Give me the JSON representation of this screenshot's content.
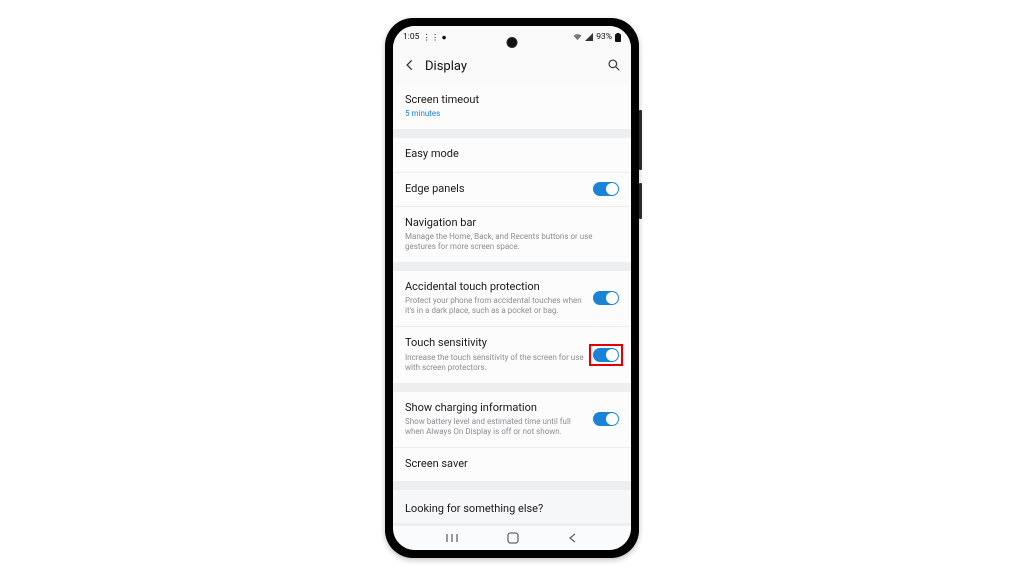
{
  "statusbar": {
    "time": "1:05",
    "battery_pct": "93%"
  },
  "header": {
    "title": "Display"
  },
  "group1": {
    "screen_timeout_label": "Screen timeout",
    "screen_timeout_value": "5 minutes"
  },
  "group2": {
    "easy_mode": "Easy mode",
    "edge_panels": "Edge panels",
    "nav_bar": "Navigation bar",
    "nav_bar_sub": "Manage the Home, Back, and Recents buttons or use gestures for more screen space."
  },
  "group3": {
    "acc_touch": "Accidental touch protection",
    "acc_touch_sub": "Protect your phone from accidental touches when it's in a dark place, such as a pocket or bag.",
    "touch_sens": "Touch sensitivity",
    "touch_sens_sub": "Increase the touch sensitivity of the screen for use with screen protectors."
  },
  "group4": {
    "charging": "Show charging information",
    "charging_sub": "Show battery level and estimated time until full when Always On Display is off or not shown.",
    "saver": "Screen saver"
  },
  "footer": {
    "prompt": "Looking for something else?"
  }
}
